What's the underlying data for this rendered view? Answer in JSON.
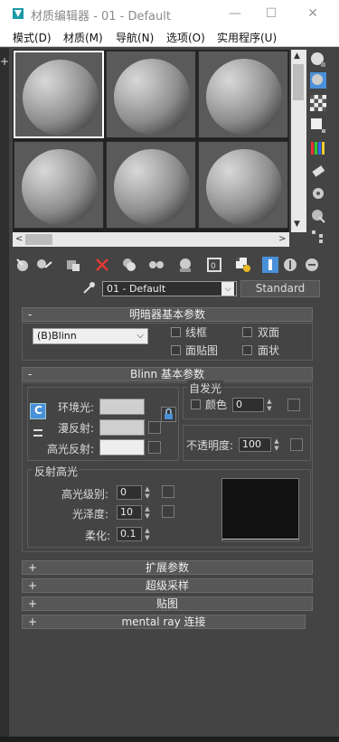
{
  "window": {
    "title": "材质编辑器 - 01 - Default",
    "minimize": "—",
    "maximize": "☐",
    "close": "✕"
  },
  "menu": [
    "模式(D)",
    "材质(M)",
    "导航(N)",
    "选项(O)",
    "实用程序(U)"
  ],
  "material": {
    "name": "01 - Default",
    "type_button": "Standard"
  },
  "shader_basic": {
    "header": "明暗器基本参数",
    "toggle": "-",
    "shader": "(B)Blinn",
    "options": [
      "线框",
      "双面",
      "面贴图",
      "面状"
    ]
  },
  "blinn_basic": {
    "header": "Blinn 基本参数",
    "toggle": "-",
    "ambient_label": "环境光:",
    "diffuse_label": "漫反射:",
    "specular_label": "高光反射:",
    "self_illum_title": "自发光",
    "color_label": "颜色",
    "color_value": "0",
    "opacity_label": "不透明度:",
    "opacity_value": "100",
    "highlight_title": "反射高光",
    "spec_level_label": "高光级别:",
    "spec_level_value": "0",
    "glossiness_label": "光泽度:",
    "glossiness_value": "10",
    "soften_label": "柔化:",
    "soften_value": "0.1",
    "lock_icon": "C"
  },
  "rollouts": [
    {
      "toggle": "+",
      "label": "扩展参数"
    },
    {
      "toggle": "+",
      "label": "超级采样"
    },
    {
      "toggle": "+",
      "label": "贴图"
    },
    {
      "toggle": "+",
      "label": "mental ray 连接"
    }
  ],
  "colors": {
    "bg": "#444444",
    "swatch": "#cfcfcf",
    "spec_swatch": "#eeeeee",
    "highlight_curve_bg": "#111111",
    "active_tool": "#4a90d9"
  }
}
